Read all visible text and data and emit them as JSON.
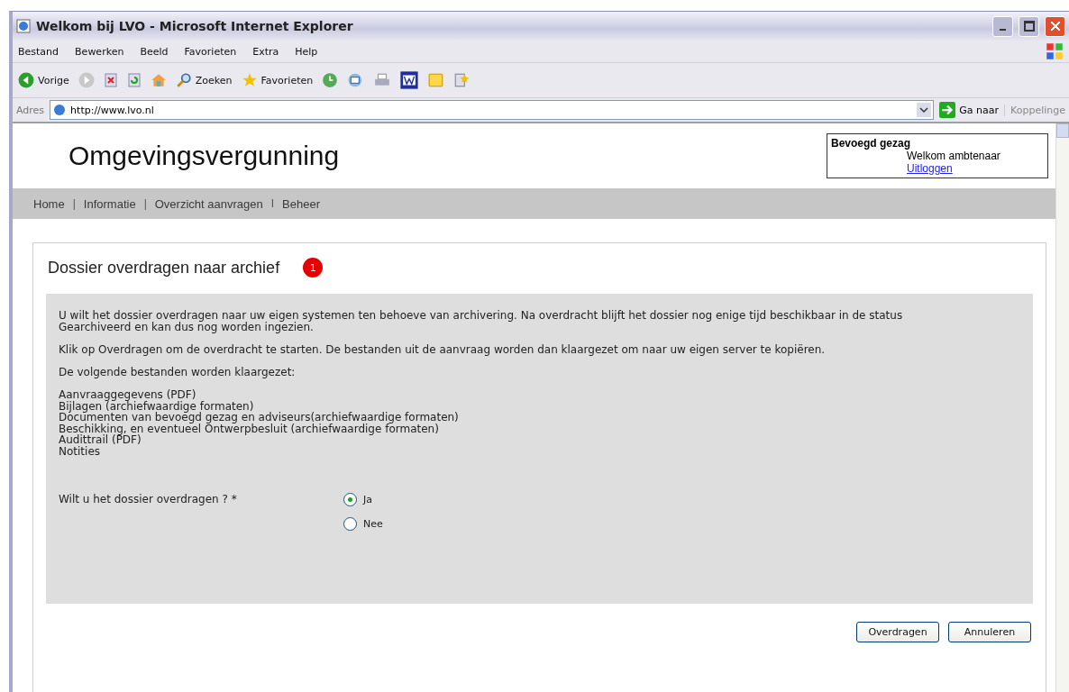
{
  "window": {
    "title": "Welkom bij LVO - Microsoft Internet Explorer"
  },
  "menu": [
    "Bestand",
    "Bewerken",
    "Beeld",
    "Favorieten",
    "Extra",
    "Help"
  ],
  "toolbar": [
    {
      "kind": "back",
      "label": "Vorige"
    },
    {
      "kind": "forward"
    },
    {
      "kind": "stop"
    },
    {
      "kind": "refresh"
    },
    {
      "kind": "home"
    },
    {
      "kind": "search",
      "label": "Zoeken"
    },
    {
      "kind": "favorites",
      "label": "Favorieten"
    },
    {
      "kind": "history"
    },
    {
      "kind": "mail"
    },
    {
      "kind": "print"
    },
    {
      "kind": "word"
    },
    {
      "kind": "notes"
    },
    {
      "kind": "messenger"
    }
  ],
  "address": {
    "label": "Adres",
    "value": "http://www.lvo.nl",
    "go": "Ga naar",
    "links": "Koppelinge"
  },
  "site": {
    "title": "Omgevingsvergunning",
    "user_box": {
      "heading": "Bevoegd gezag",
      "welcome": "Welkom ambtenaar",
      "logout": "Uitloggen"
    }
  },
  "nav": [
    {
      "kind": "link",
      "label": "Home"
    },
    {
      "kind": "separator",
      "label": "|"
    },
    {
      "kind": "link",
      "label": "Informatie"
    },
    {
      "kind": "separator",
      "label": "|"
    },
    {
      "kind": "link",
      "label": "Overzicht aanvragen"
    },
    {
      "kind": "separator",
      "label": "I"
    },
    {
      "kind": "link",
      "label": "Beheer"
    }
  ],
  "panel": {
    "title": "Dossier overdragen naar archief",
    "badge": "1",
    "paragraphs": [
      "U wilt het dossier overdragen naar uw eigen systemen ten behoeve van archivering. Na overdracht blijft het dossier nog enige tijd beschikbaar in de status Gearchiveerd en kan dus nog worden ingezien.",
      "Klik op Overdragen om de overdracht te starten. De bestanden uit de aanvraag worden dan klaargezet om naar uw eigen server te kopiëren.",
      "De volgende bestanden worden klaargezet:"
    ],
    "files": [
      "Aanvraaggegevens (PDF)",
      "Bijlagen (archiefwaardige formaten)",
      "Documenten van bevoegd gezag en adviseurs(archiefwaardige formaten)",
      "Beschikking, en eventueel Ontwerpbesluit (archiefwaardige formaten)",
      "Audittrail (PDF)",
      "Notities"
    ],
    "question": "Wilt u het dossier overdragen ? *",
    "options": [
      {
        "label": "Ja",
        "selected": true
      },
      {
        "label": "Nee",
        "selected": false
      }
    ],
    "buttons": [
      "Overdragen",
      "Annuleren"
    ]
  }
}
